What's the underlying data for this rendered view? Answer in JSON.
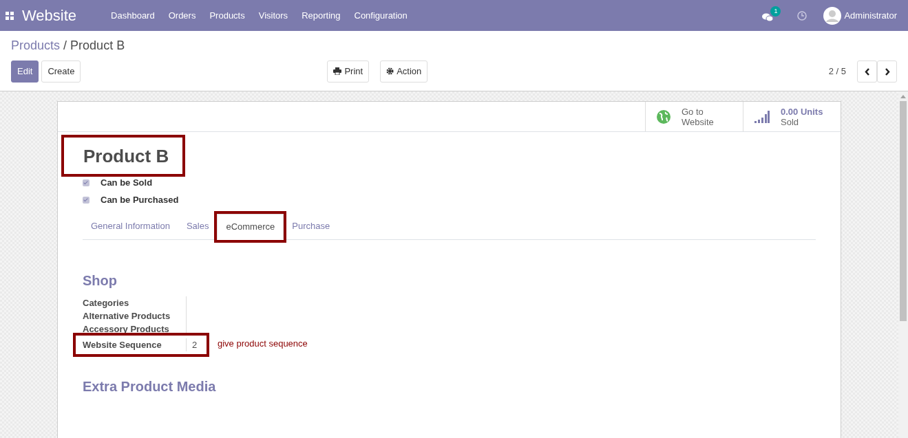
{
  "navbar": {
    "app_title": "Website",
    "menu": [
      "Dashboard",
      "Orders",
      "Products",
      "Visitors",
      "Reporting",
      "Configuration"
    ],
    "message_count": "1",
    "user": "Administrator"
  },
  "breadcrumb": {
    "parent": "Products",
    "separator": "/",
    "current": "Product B"
  },
  "buttons": {
    "edit": "Edit",
    "create": "Create",
    "print": "Print",
    "action": "Action"
  },
  "pager": "2 / 5",
  "smart_buttons": [
    {
      "kind": "globe",
      "line1": "Go to",
      "line2": "Website"
    },
    {
      "kind": "chart",
      "line1": "0.00 Units",
      "line2": "Sold"
    }
  ],
  "product": {
    "name": "Product B",
    "highlighted": true
  },
  "options": [
    {
      "label": "Can be Sold",
      "checked": true
    },
    {
      "label": "Can be Purchased",
      "checked": true
    }
  ],
  "tabs": [
    {
      "label": "General Information",
      "selected": false,
      "highlighted": false
    },
    {
      "label": "Sales",
      "selected": false,
      "highlighted": false
    },
    {
      "label": "eCommerce",
      "selected": true,
      "highlighted": true
    },
    {
      "label": "Purchase",
      "selected": false,
      "highlighted": false
    }
  ],
  "shop": {
    "heading": "Shop",
    "fields": [
      {
        "label": "Categories",
        "highlighted": false
      },
      {
        "label": "Alternative Products",
        "highlighted": false
      },
      {
        "label": "Accessory Products",
        "highlighted": false
      },
      {
        "label": "Website Sequence",
        "value": "2",
        "highlighted": true
      }
    ],
    "note": "give product sequence"
  },
  "media_heading": "Extra Product Media"
}
